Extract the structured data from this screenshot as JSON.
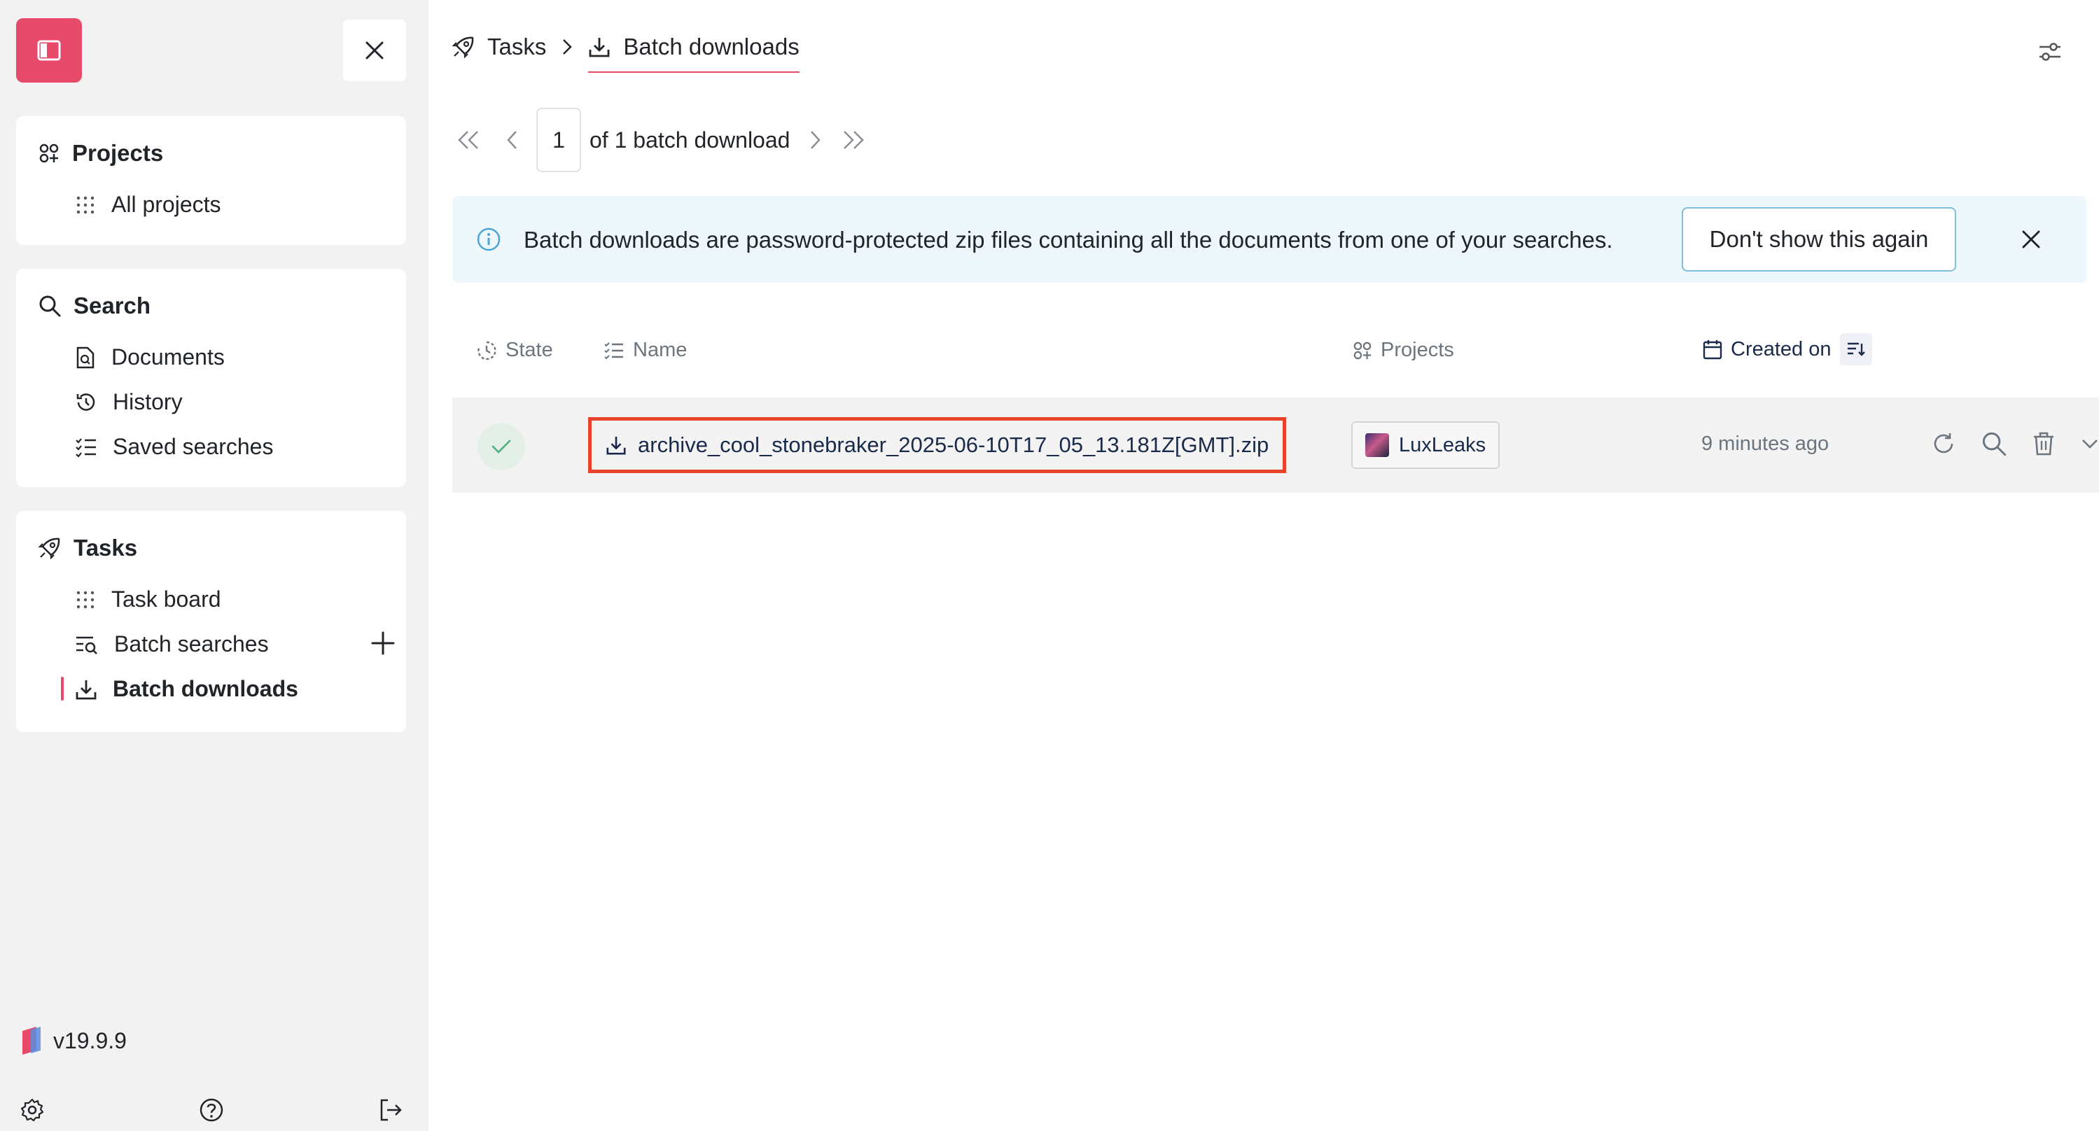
{
  "sidebar": {
    "projects": {
      "title": "Projects",
      "items": [
        {
          "label": "All projects"
        }
      ]
    },
    "search": {
      "title": "Search",
      "items": [
        {
          "label": "Documents"
        },
        {
          "label": "History"
        },
        {
          "label": "Saved searches"
        }
      ]
    },
    "tasks": {
      "title": "Tasks",
      "items": [
        {
          "label": "Task board"
        },
        {
          "label": "Batch searches"
        },
        {
          "label": "Batch downloads"
        }
      ],
      "active_item": "Batch downloads"
    },
    "version": "v19.9.9"
  },
  "breadcrumb": {
    "parent": "Tasks",
    "current": "Batch downloads"
  },
  "pagination": {
    "current_page": "1",
    "total_text": "of 1 batch download"
  },
  "info_banner": {
    "text": "Batch downloads are password-protected zip files containing all the documents from one of your searches.",
    "dismiss_label": "Don't show this again"
  },
  "table": {
    "columns": {
      "state": "State",
      "name": "Name",
      "projects": "Projects",
      "created_on": "Created on"
    },
    "rows": [
      {
        "state": "done",
        "name": "archive_cool_stonebraker_2025-06-10T17_05_13.181Z[GMT].zip",
        "project": "LuxLeaks",
        "created": "9 minutes ago"
      }
    ]
  },
  "colors": {
    "accent": "#e84a6b",
    "info_bg": "#eef8fc",
    "highlight_border": "#e8432a",
    "success_bg": "#e3efe7",
    "success": "#4caf7a"
  }
}
